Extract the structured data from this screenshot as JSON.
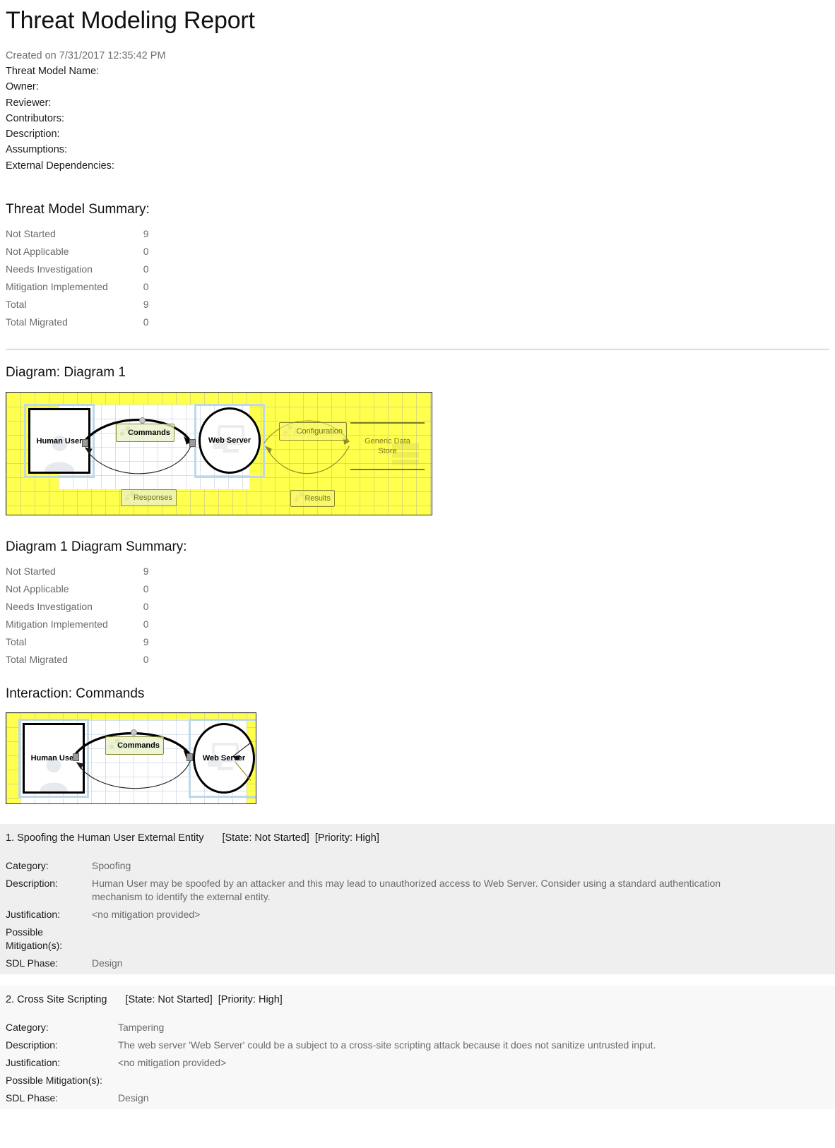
{
  "report": {
    "title": "Threat Modeling Report",
    "created_on": "Created on 7/31/2017 12:35:42 PM",
    "fields": [
      "Threat Model Name:",
      "Owner:",
      "Reviewer:",
      "Contributors:",
      "Description:",
      "Assumptions:",
      "External Dependencies:"
    ]
  },
  "threat_model_summary": {
    "heading": "Threat Model Summary:",
    "rows": [
      {
        "label": "Not Started",
        "value": "9"
      },
      {
        "label": "Not Applicable",
        "value": "0"
      },
      {
        "label": "Needs Investigation",
        "value": "0"
      },
      {
        "label": "Mitigation Implemented",
        "value": "0"
      },
      {
        "label": "Total",
        "value": "9"
      },
      {
        "label": "Total Migrated",
        "value": "0"
      }
    ]
  },
  "diagram_section": {
    "heading": "Diagram: Diagram 1",
    "nodes": {
      "human_user": "Human User",
      "web_server": "Web Server",
      "generic_data_store_line1": "Generic Data",
      "generic_data_store_line2": "Store"
    },
    "flows": {
      "commands": "Commands",
      "responses": "Responses",
      "configuration": "Configuration",
      "results": "Results"
    },
    "colors": {
      "canvas": "#ffff4d",
      "selection": "#bcd8ea",
      "flow_label_text": "#6f6f22",
      "datastore_text": "#7a7a20"
    }
  },
  "diagram_summary": {
    "heading": "Diagram 1 Diagram Summary:",
    "rows": [
      {
        "label": "Not Started",
        "value": "9"
      },
      {
        "label": "Not Applicable",
        "value": "0"
      },
      {
        "label": "Needs Investigation",
        "value": "0"
      },
      {
        "label": "Mitigation Implemented",
        "value": "0"
      },
      {
        "label": "Total",
        "value": "9"
      },
      {
        "label": "Total Migrated",
        "value": "0"
      }
    ]
  },
  "interaction": {
    "heading": "Interaction: Commands",
    "nodes": {
      "human_user": "Human User",
      "web_server": "Web Server"
    },
    "flows": {
      "commands": "Commands"
    }
  },
  "threats": [
    {
      "head_name": "1. Spoofing the Human User External Entity",
      "head_state": "[State: Not Started]",
      "head_priority": "[Priority: High]",
      "keys": {
        "category": "Category:",
        "description": "Description:",
        "justification": "Justification:",
        "mitigation_line1": "Possible",
        "mitigation_line2": "Mitigation(s):",
        "sdl": "SDL Phase:"
      },
      "category": "Spoofing",
      "description": "Human User may be spoofed by an attacker and this may lead to unauthorized access to Web Server. Consider using a standard authentication mechanism to identify the external entity.",
      "justification": "<no mitigation provided>",
      "mitigations": "",
      "sdl_phase": "Design"
    },
    {
      "head_name": "2. Cross Site Scripting",
      "head_state": "[State: Not Started]",
      "head_priority": "[Priority: High]",
      "keys": {
        "category": "Category:",
        "description": "Description:",
        "justification": "Justification:",
        "mitigation": "Possible Mitigation(s):",
        "sdl": "SDL Phase:"
      },
      "category": "Tampering",
      "description": "The web server 'Web Server' could be a subject to a cross-site scripting attack because it does not sanitize untrusted input.",
      "justification": "<no mitigation provided>",
      "mitigations": "",
      "sdl_phase": "Design"
    }
  ]
}
